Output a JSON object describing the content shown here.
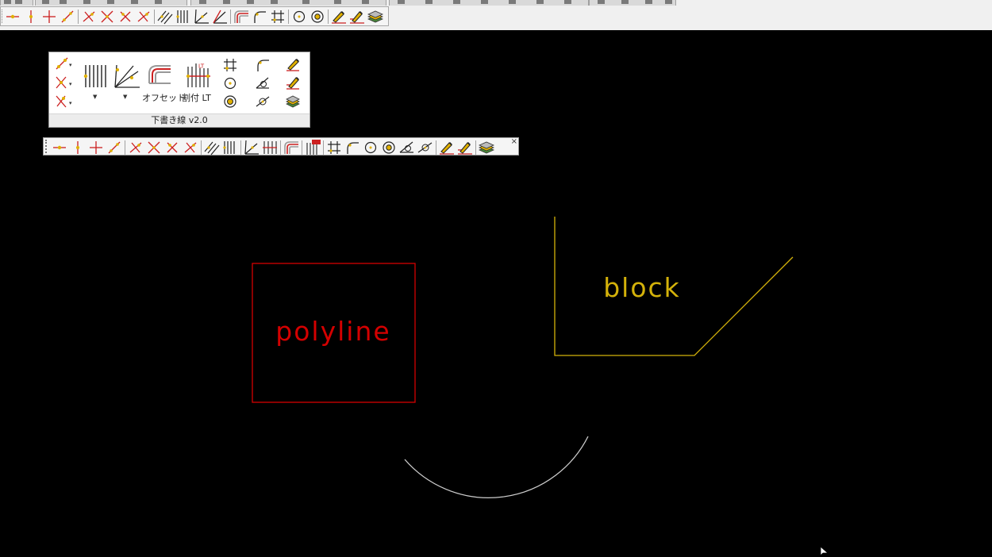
{
  "colors": {
    "background": "#000000",
    "polyline": "#d40000",
    "block": "#d4b20a",
    "arc": "#cccccc",
    "icon_red": "#cc2020",
    "icon_yellow": "#e0b000"
  },
  "ribbon": {
    "offset_label": "オフセット",
    "divide_label": "割付 LT",
    "footer_label": "下書き線 v2.0"
  },
  "floating_toolbar": {
    "close_glyph": "×"
  },
  "drawing": {
    "polyline_label": "polyline",
    "block_label": "block"
  }
}
